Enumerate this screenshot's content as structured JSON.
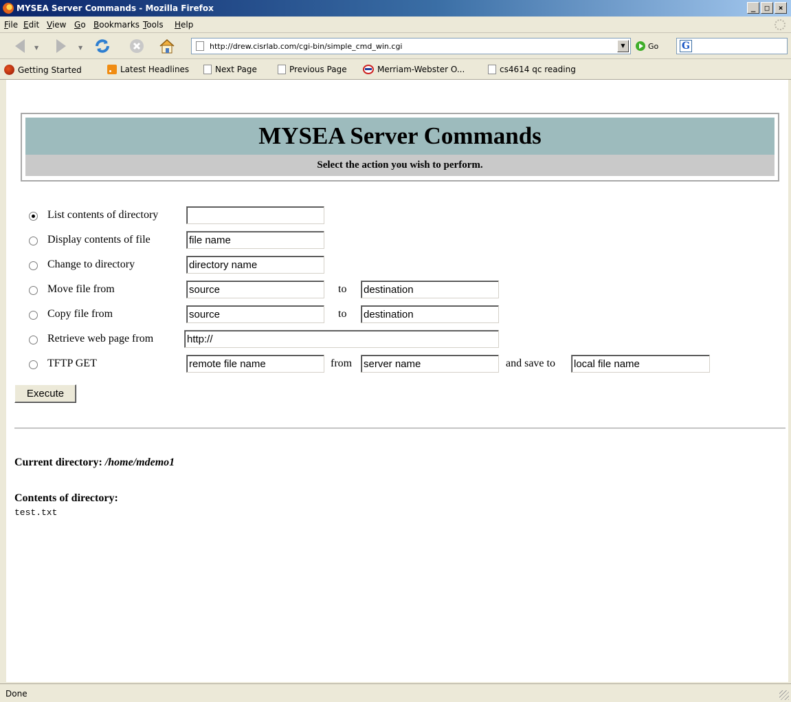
{
  "window": {
    "title": "MYSEA Server Commands - Mozilla Firefox",
    "controls": [
      "_",
      "□",
      "×"
    ]
  },
  "menubar": {
    "items": [
      "File",
      "Edit",
      "View",
      "Go",
      "Bookmarks",
      "Tools",
      "Help"
    ]
  },
  "navbar": {
    "url": "http://drew.cisrlab.com/cgi-bin/simple_cmd_win.cgi",
    "go_label": "Go"
  },
  "bookmarks": {
    "items": [
      "Getting Started",
      "Latest Headlines",
      "Next Page",
      "Previous Page",
      "Merriam-Webster O...",
      "cs4614 qc reading"
    ]
  },
  "page": {
    "heading": "MYSEA Server Commands",
    "subheading": "Select the action you wish to perform.",
    "rows": [
      {
        "label": "List contents of directory",
        "checked": true,
        "fields": [
          ""
        ]
      },
      {
        "label": "Display contents of file",
        "checked": false,
        "fields": [
          "file name"
        ]
      },
      {
        "label": "Change to directory",
        "checked": false,
        "fields": [
          "directory name"
        ]
      },
      {
        "label": "Move file from",
        "checked": false,
        "fields": [
          "source",
          "destination"
        ],
        "joiners": [
          "to"
        ]
      },
      {
        "label": "Copy file from",
        "checked": false,
        "fields": [
          "source",
          "destination"
        ],
        "joiners": [
          "to"
        ]
      },
      {
        "label": "Retrieve web page from",
        "checked": false,
        "fields": [
          "http://"
        ]
      },
      {
        "label": "TFTP GET",
        "checked": false,
        "fields": [
          "remote file name",
          "server name",
          "local file name"
        ],
        "joiners": [
          "from",
          "and save to"
        ]
      }
    ],
    "execute_label": "Execute",
    "current_dir_label": "Current directory:",
    "current_dir_value": "/home/mdemo1",
    "contents_label": "Contents of directory:",
    "files": [
      "test.txt"
    ]
  },
  "status": {
    "text": "Done"
  }
}
